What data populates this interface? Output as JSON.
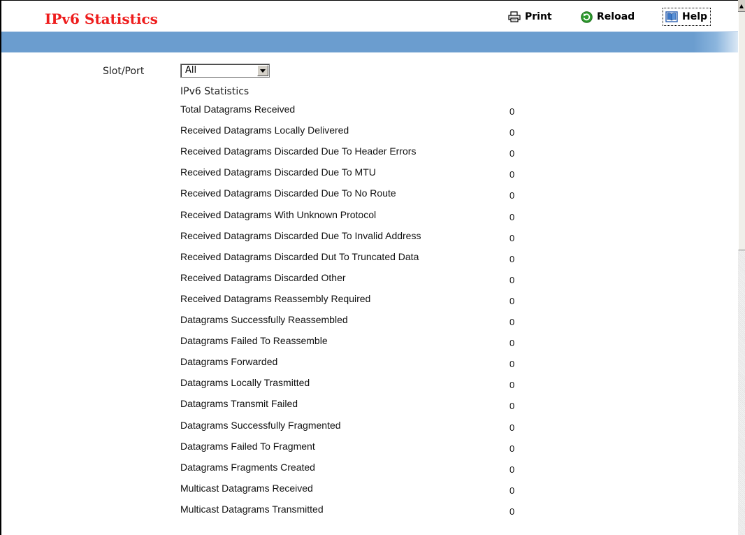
{
  "header": {
    "title": "IPv6 Statistics",
    "print_label": "Print",
    "reload_label": "Reload",
    "help_label": "Help"
  },
  "filter": {
    "label": "Slot/Port",
    "selected": "All"
  },
  "section_title": "IPv6 Statistics",
  "stats": [
    {
      "label": "Total Datagrams Received",
      "value": "0"
    },
    {
      "label": "Received Datagrams Locally Delivered",
      "value": "0"
    },
    {
      "label": "Received Datagrams Discarded Due To Header Errors",
      "value": "0"
    },
    {
      "label": "Received Datagrams Discarded Due To MTU",
      "value": "0"
    },
    {
      "label": "Received Datagrams Discarded Due To No Route",
      "value": "0"
    },
    {
      "label": "Received Datagrams With Unknown Protocol",
      "value": "0"
    },
    {
      "label": "Received Datagrams Discarded Due To Invalid Address",
      "value": "0"
    },
    {
      "label": "Received Datagrams Discarded Dut To Truncated Data",
      "value": "0"
    },
    {
      "label": "Received Datagrams Discarded Other",
      "value": "0"
    },
    {
      "label": "Received Datagrams Reassembly Required",
      "value": "0"
    },
    {
      "label": "Datagrams Successfully Reassembled",
      "value": "0"
    },
    {
      "label": "Datagrams Failed To Reassemble",
      "value": "0"
    },
    {
      "label": "Datagrams Forwarded",
      "value": "0"
    },
    {
      "label": "Datagrams Locally Trasmitted",
      "value": "0"
    },
    {
      "label": "Datagrams Transmit Failed",
      "value": "0"
    },
    {
      "label": "Datagrams Successfully Fragmented",
      "value": "0"
    },
    {
      "label": "Datagrams Failed To Fragment",
      "value": "0"
    },
    {
      "label": "Datagrams Fragments Created",
      "value": "0"
    },
    {
      "label": "Multicast Datagrams Received",
      "value": "0"
    },
    {
      "label": "Multicast Datagrams Transmitted",
      "value": "0"
    }
  ],
  "colors": {
    "title": "#ee1c1c",
    "bar": "#6b9dcf"
  },
  "icons": {
    "print": "printer-icon",
    "reload": "reload-icon",
    "help": "help-book-icon"
  }
}
